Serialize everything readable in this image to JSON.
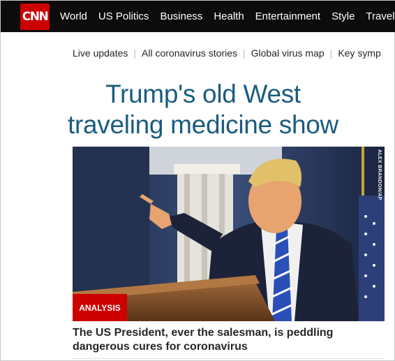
{
  "brand": {
    "logo_text": "CNN",
    "color": "#cc0000"
  },
  "nav": {
    "items": [
      "World",
      "US Politics",
      "Business",
      "Health",
      "Entertainment",
      "Style",
      "Travel"
    ]
  },
  "subnav": {
    "items": [
      "Live updates",
      "All coronavirus stories",
      "Global virus map",
      "Key symp"
    ]
  },
  "article": {
    "headline_line1": "Trump's old West",
    "headline_line2": "traveling medicine show",
    "photo_credit": "ALEX BRANDON/AP",
    "badge": "ANALYSIS",
    "caption": "The US President, ever the salesman, is peddling dangerous cures for coronavirus"
  },
  "colors": {
    "headline": "#1b5c80",
    "nav_bg": "#0c0c0c",
    "badge_bg": "#cc0000"
  }
}
